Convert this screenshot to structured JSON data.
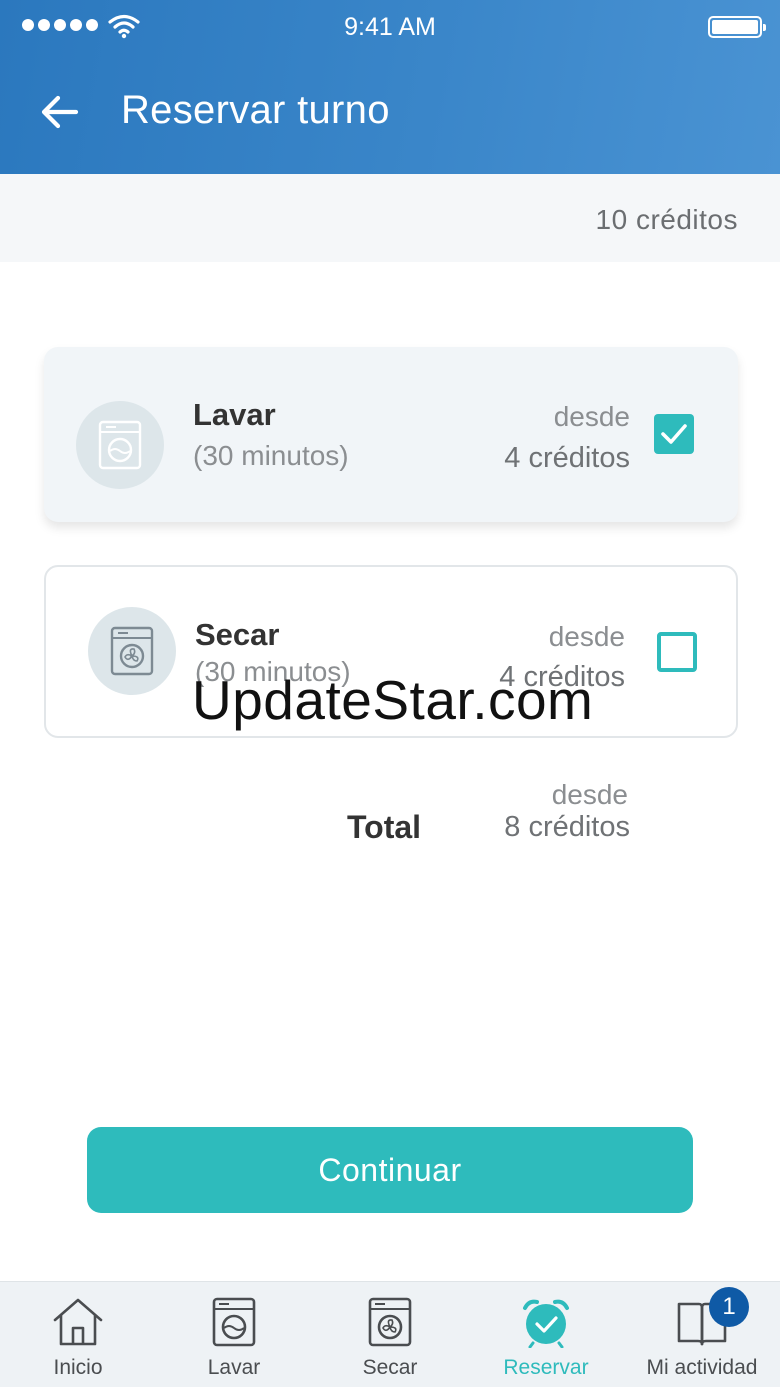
{
  "status_bar": {
    "time": "9:41 AM",
    "signal_icon": "signal-dots-icon",
    "wifi_icon": "wifi-icon",
    "battery_icon": "battery-icon"
  },
  "header": {
    "title": "Reservar turno",
    "back_icon": "arrow-left-icon"
  },
  "credits_bar": {
    "credits": "10 créditos"
  },
  "services": [
    {
      "name": "Lavar",
      "duration": "(30 minutos)",
      "from_label": "desde",
      "price": "4 créditos",
      "selected": true,
      "icon": "washing-machine-icon"
    },
    {
      "name": "Secar",
      "duration": "(30 minutos)",
      "from_label": "desde",
      "price": "4 créditos",
      "selected": false,
      "icon": "dryer-icon"
    }
  ],
  "total": {
    "from_label": "desde",
    "label": "Total",
    "price": "8 créditos"
  },
  "watermark": "UpdateStar.com",
  "cta": {
    "label": "Continuar"
  },
  "tabs": [
    {
      "label": "Inicio",
      "icon": "home-icon",
      "active": false
    },
    {
      "label": "Lavar",
      "icon": "washing-machine-icon",
      "active": false
    },
    {
      "label": "Secar",
      "icon": "dryer-icon",
      "active": false
    },
    {
      "label": "Reservar",
      "icon": "alarm-clock-icon",
      "active": true
    },
    {
      "label": "Mi actividad",
      "icon": "book-icon",
      "active": false,
      "badge": "1"
    }
  ],
  "colors": {
    "header": "#2b78be",
    "accent": "#2ebbbc",
    "badge": "#0f5aa6"
  }
}
